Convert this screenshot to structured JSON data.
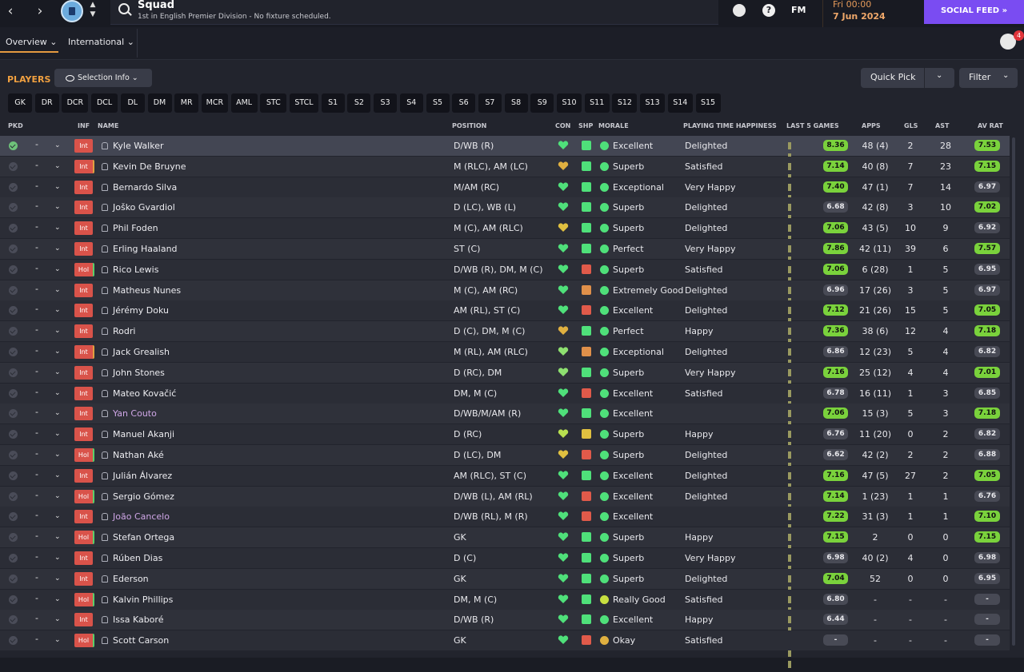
{
  "header": {
    "title": "Squad",
    "subtitle": "1st in English Premier Division - No fixture scheduled.",
    "fm_label": "FM",
    "date_day": "Fri 00:00",
    "date_date": "7 Jun 2024",
    "social_feed": "SOCIAL FEED  »",
    "back_icon": "‹",
    "forward_icon": "›",
    "help_icon": "?",
    "updown_icon": "▲\n▼",
    "notifications_count": "4"
  },
  "subnav": {
    "tabs": [
      "Overview ⌄",
      "International ⌄"
    ]
  },
  "toolbar": {
    "players_label": "PLAYERS",
    "selection_info": "Selection Info  ⌄",
    "quick_pick": "Quick Pick",
    "filter": "Filter",
    "chevron": "⌄"
  },
  "positions": [
    "GK",
    "DR",
    "DCR",
    "DCL",
    "DL",
    "DM",
    "MR",
    "MCR",
    "AML",
    "STC",
    "STCL",
    "S1",
    "S2",
    "S3",
    "S4",
    "S5",
    "S6",
    "S7",
    "S8",
    "S9",
    "S10",
    "S11",
    "S12",
    "S13",
    "S14",
    "S15"
  ],
  "columns": {
    "pkd": "PKD",
    "inf": "INF",
    "name": "NAME",
    "position": "POSITION",
    "con": "CON",
    "shp": "SHP",
    "morale": "MORALE",
    "pth": "PLAYING TIME HAPPINESS",
    "l5": "LAST 5 GAMES",
    "apps": "APPS",
    "gls": "GLS",
    "ast": "AST",
    "avrat": "AV RAT"
  },
  "colors": {
    "accent_orange": "#f0a040",
    "social_purple": "#7a4cf2",
    "good_green": "#7ad23c",
    "inf_red": "#d9534a"
  },
  "players": [
    {
      "name": "Kyle Walker",
      "inf": "Int",
      "position": "D/WB (R)",
      "morale": "Excellent",
      "pth": "Delighted",
      "l5": "8.36",
      "apps": "48 (4)",
      "gls": "2",
      "ast": "28",
      "avrat": "7.53",
      "sel": true
    },
    {
      "name": "Kevin De Bruyne",
      "inf": "Int",
      "position": "M (RLC), AM (LC)",
      "morale": "Superb",
      "pth": "Satisfied",
      "l5": "7.14",
      "apps": "40 (8)",
      "gls": "7",
      "ast": "23",
      "avrat": "7.15"
    },
    {
      "name": "Bernardo Silva",
      "inf": "Int",
      "position": "M/AM (RC)",
      "morale": "Exceptional",
      "pth": "Very Happy",
      "l5": "7.40",
      "apps": "47 (1)",
      "gls": "7",
      "ast": "14",
      "avrat": "6.97"
    },
    {
      "name": "Joško Gvardiol",
      "inf": "Int",
      "position": "D (LC), WB (L)",
      "morale": "Superb",
      "pth": "Delighted",
      "l5": "6.68",
      "apps": "42 (8)",
      "gls": "3",
      "ast": "10",
      "avrat": "7.02"
    },
    {
      "name": "Phil Foden",
      "inf": "Int",
      "position": "M (C), AM (RLC)",
      "morale": "Superb",
      "pth": "Delighted",
      "l5": "7.06",
      "apps": "43 (5)",
      "gls": "10",
      "ast": "9",
      "avrat": "6.92"
    },
    {
      "name": "Erling Haaland",
      "inf": "Int",
      "position": "ST (C)",
      "morale": "Perfect",
      "pth": "Very Happy",
      "l5": "7.86",
      "apps": "42 (11)",
      "gls": "39",
      "ast": "6",
      "avrat": "7.57"
    },
    {
      "name": "Rico Lewis",
      "inf": "Hol",
      "position": "D/WB (R), DM, M (C)",
      "morale": "Superb",
      "pth": "Satisfied",
      "l5": "7.06",
      "apps": "6 (28)",
      "gls": "1",
      "ast": "5",
      "avrat": "6.95"
    },
    {
      "name": "Matheus Nunes",
      "inf": "Int",
      "position": "M (C), AM (RC)",
      "morale": "Extremely Good",
      "pth": "Delighted",
      "l5": "6.96",
      "apps": "17 (26)",
      "gls": "3",
      "ast": "5",
      "avrat": "6.97"
    },
    {
      "name": "Jérémy Doku",
      "inf": "Int",
      "position": "AM (RL), ST (C)",
      "morale": "Excellent",
      "pth": "Delighted",
      "l5": "7.12",
      "apps": "21 (26)",
      "gls": "15",
      "ast": "5",
      "avrat": "7.05"
    },
    {
      "name": "Rodri",
      "inf": "Int",
      "position": "D (C), DM, M (C)",
      "morale": "Perfect",
      "pth": "Happy",
      "l5": "7.36",
      "apps": "38 (6)",
      "gls": "12",
      "ast": "4",
      "avrat": "7.18"
    },
    {
      "name": "Jack Grealish",
      "inf": "Int",
      "position": "M (RL), AM (RLC)",
      "morale": "Exceptional",
      "pth": "Delighted",
      "l5": "6.86",
      "apps": "12 (23)",
      "gls": "5",
      "ast": "4",
      "avrat": "6.82"
    },
    {
      "name": "John Stones",
      "inf": "Int",
      "position": "D (RC), DM",
      "morale": "Superb",
      "pth": "Very Happy",
      "l5": "7.16",
      "apps": "25 (12)",
      "gls": "4",
      "ast": "4",
      "avrat": "7.01"
    },
    {
      "name": "Mateo Kovačić",
      "inf": "Int",
      "position": "DM, M (C)",
      "morale": "Excellent",
      "pth": "Satisfied",
      "l5": "6.78",
      "apps": "16 (11)",
      "gls": "1",
      "ast": "3",
      "avrat": "6.85"
    },
    {
      "name": "Yan Couto",
      "inf": "Int",
      "position": "D/WB/M/AM (R)",
      "morale": "Excellent",
      "pth": "",
      "l5": "7.06",
      "apps": "15 (3)",
      "gls": "5",
      "ast": "3",
      "avrat": "7.18",
      "loan": true
    },
    {
      "name": "Manuel Akanji",
      "inf": "Int",
      "position": "D (RC)",
      "morale": "Superb",
      "pth": "Happy",
      "l5": "6.76",
      "apps": "11 (20)",
      "gls": "0",
      "ast": "2",
      "avrat": "6.82"
    },
    {
      "name": "Nathan Aké",
      "inf": "Hol",
      "position": "D (LC), DM",
      "morale": "Superb",
      "pth": "Delighted",
      "l5": "6.62",
      "apps": "42 (2)",
      "gls": "2",
      "ast": "2",
      "avrat": "6.88"
    },
    {
      "name": "Julián Álvarez",
      "inf": "Int",
      "position": "AM (RLC), ST (C)",
      "morale": "Excellent",
      "pth": "Delighted",
      "l5": "7.16",
      "apps": "47 (5)",
      "gls": "27",
      "ast": "2",
      "avrat": "7.05"
    },
    {
      "name": "Sergio Gómez",
      "inf": "Hol",
      "position": "D/WB (L), AM (RL)",
      "morale": "Excellent",
      "pth": "Delighted",
      "l5": "7.14",
      "apps": "1 (23)",
      "gls": "1",
      "ast": "1",
      "avrat": "6.76"
    },
    {
      "name": "João Cancelo",
      "inf": "Int",
      "position": "D/WB (RL), M (R)",
      "morale": "Excellent",
      "pth": "",
      "l5": "7.22",
      "apps": "31 (3)",
      "gls": "1",
      "ast": "1",
      "avrat": "7.10",
      "loan": true
    },
    {
      "name": "Stefan Ortega",
      "inf": "Hol",
      "position": "GK",
      "morale": "Superb",
      "pth": "Happy",
      "l5": "7.15",
      "apps": "2",
      "gls": "0",
      "ast": "0",
      "avrat": "7.15"
    },
    {
      "name": "Rúben Dias",
      "inf": "Int",
      "position": "D (C)",
      "morale": "Superb",
      "pth": "Very Happy",
      "l5": "6.98",
      "apps": "40 (2)",
      "gls": "4",
      "ast": "0",
      "avrat": "6.98"
    },
    {
      "name": "Ederson",
      "inf": "Int",
      "position": "GK",
      "morale": "Superb",
      "pth": "Delighted",
      "l5": "7.04",
      "apps": "52",
      "gls": "0",
      "ast": "0",
      "avrat": "6.95"
    },
    {
      "name": "Kalvin Phillips",
      "inf": "Hol",
      "position": "DM, M (C)",
      "morale": "Really Good",
      "pth": "Satisfied",
      "l5": "6.80",
      "apps": "-",
      "gls": "-",
      "ast": "-",
      "avrat": "-"
    },
    {
      "name": "Issa Kaboré",
      "inf": "Int",
      "position": "D/WB (R)",
      "morale": "Excellent",
      "pth": "Happy",
      "l5": "6.44",
      "apps": "-",
      "gls": "-",
      "ast": "-",
      "avrat": "-"
    },
    {
      "name": "Scott Carson",
      "inf": "Hol",
      "position": "GK",
      "morale": "Okay",
      "pth": "Satisfied",
      "l5": "-",
      "apps": "-",
      "gls": "-",
      "ast": "-",
      "avrat": "-"
    }
  ]
}
